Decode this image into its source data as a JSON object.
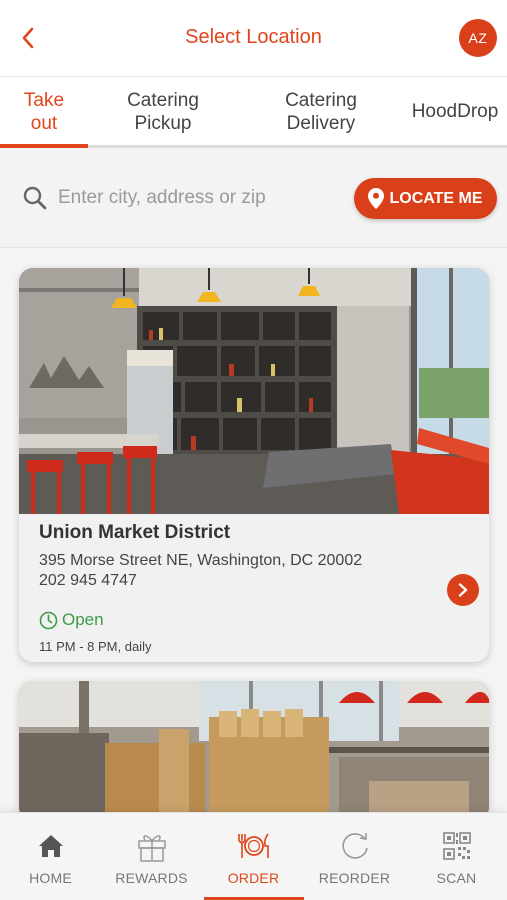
{
  "header": {
    "title": "Select Location",
    "avatar_initials": "AZ",
    "back_icon": "chevron-left-icon"
  },
  "tabs": [
    {
      "label": "Take\nout",
      "active": true
    },
    {
      "label": "Catering\nPickup",
      "active": false
    },
    {
      "label": "Catering\nDelivery",
      "active": false
    },
    {
      "label": "HoodDrop",
      "active": false
    }
  ],
  "search": {
    "placeholder": "Enter city, address or zip",
    "value": "",
    "locate_label": "LOCATE ME"
  },
  "locations": [
    {
      "name": "Union Market District",
      "address": "395 Morse Street NE, Washington, DC 20002",
      "phone": "202 945 4747",
      "status": "Open",
      "hours": "11 PM - 8 PM, daily"
    }
  ],
  "bottom_nav": [
    {
      "label": "HOME",
      "icon": "home-icon",
      "active": false
    },
    {
      "label": "REWARDS",
      "icon": "gift-icon",
      "active": false
    },
    {
      "label": "ORDER",
      "icon": "plate-utensils-icon",
      "active": true
    },
    {
      "label": "REORDER",
      "icon": "reorder-icon",
      "active": false
    },
    {
      "label": "SCAN",
      "icon": "qr-code-icon",
      "active": false
    }
  ],
  "colors": {
    "accent": "#e0451b",
    "open_green": "#3d9a46"
  }
}
